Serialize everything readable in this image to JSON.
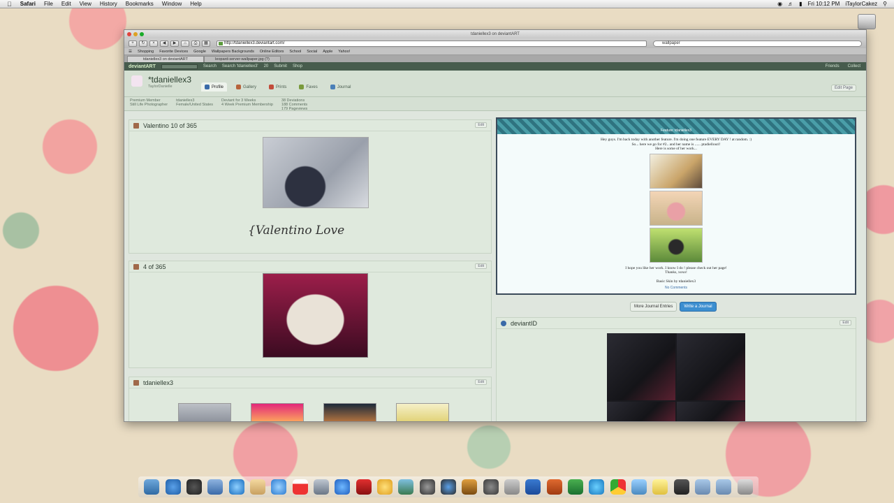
{
  "menubar": {
    "items": [
      "Safari",
      "File",
      "Edit",
      "View",
      "History",
      "Bookmarks",
      "Window",
      "Help"
    ],
    "clock": "Fri 10:12 PM",
    "user": "iTaylorCakez"
  },
  "window": {
    "title": "tdaniellex3 on deviantART",
    "url": "http://tdaniellex3.deviantart.com/",
    "search_value": "wallpaper",
    "bookmarks": [
      "Shopping",
      "Favorite Devices",
      "Google",
      "Wallpapers Backgrounds",
      "Online Editors",
      "School",
      "Social",
      "Apple",
      "Yahoo!"
    ],
    "tabs": [
      "tdaniellex3 on deviantART",
      "leopard-server-wallpaper.jpg (?)"
    ]
  },
  "da_header": {
    "logo": "deviantART",
    "search_placeholder": "Search",
    "search_in": "Search 'tdaniellex3'",
    "count": "20",
    "submit": "Submit",
    "shop": "Shop",
    "friends": "Friends",
    "collect": "Collect"
  },
  "profile": {
    "username": "*tdaniellex3",
    "realname": "TaylorDanielle",
    "tabs": [
      "Profile",
      "Gallery",
      "Prints",
      "Faves",
      "Journal"
    ],
    "edit_page": "Edit Page",
    "info": {
      "membership": "Premium Member",
      "role": "Still Life Photographer",
      "handle": "tdaniellex3",
      "location": "Female/United States",
      "deviant_for": "Deviant for 3 Weeks",
      "premium": "4 Week Premium Membership",
      "stats": [
        "38 Deviations",
        "188 Comments",
        "179 Pageviews"
      ]
    }
  },
  "widgets": {
    "w1": {
      "title": "Valentino 10 of 365",
      "caption": "{Valentino Love",
      "edit": "Edit"
    },
    "w2": {
      "title": "4 of 365",
      "edit": "Edit"
    },
    "w3": {
      "title": "tdaniellex3",
      "edit": "Edit"
    },
    "journal": {
      "banner_text": "Feature: tdaniellex3",
      "lines": [
        "Hey guys. I'm back today with another feature. I'm doing one feature EVERY DAY ! at random. :)",
        "So... here we go for #2.. and her name is ...... ptadiellouri!",
        "Here is some of her work..."
      ],
      "footer": [
        "I hope you like her work. I know I do ! please check out her page!",
        "Thanks, xoxo!"
      ],
      "credit": "Basic Skin by tdaniellex3",
      "comments": "No Comments"
    },
    "journal_buttons": {
      "more": "More Journal Entries",
      "write": "Write a Journal"
    },
    "deviantid": {
      "title": "deviantID",
      "edit": "Edit"
    }
  }
}
